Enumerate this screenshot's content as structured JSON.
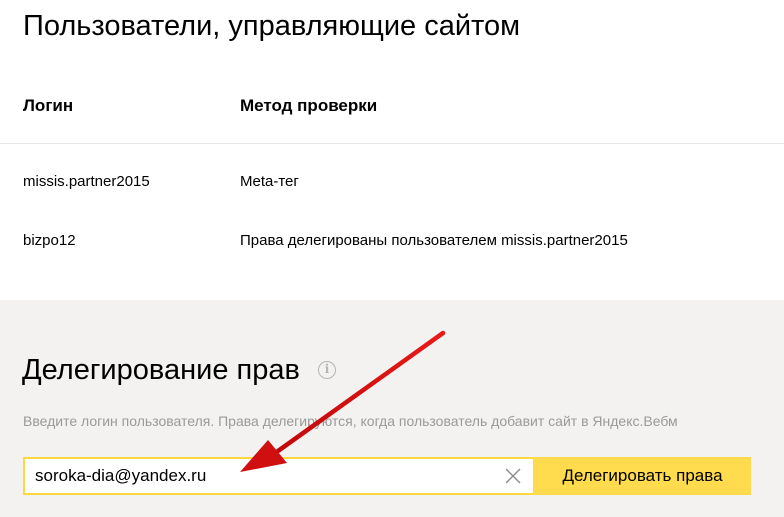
{
  "users_section": {
    "title": "Пользователи, управляющие сайтом",
    "columns": [
      "Логин",
      "Метод проверки"
    ],
    "rows": [
      {
        "login": "missis.partner2015",
        "method": "Meta-тег"
      },
      {
        "login": "bizpo12",
        "method": "Права делегированы пользователем missis.partner2015"
      }
    ]
  },
  "delegation": {
    "title": "Делегирование прав",
    "info_icon": "info-icon",
    "hint": "Введите логин пользователя. Права делегируются, когда пользователь добавит сайт в Яндекс.Вебм",
    "input_value": "soroka-dia@yandex.ru",
    "clear_icon": "close-icon",
    "button_label": "Делегировать права"
  },
  "colors": {
    "accent_yellow": "#ffdb4d",
    "input_border": "#ffd83d",
    "arrow": "#e01010",
    "bottom_bg": "#f3f2f0"
  }
}
